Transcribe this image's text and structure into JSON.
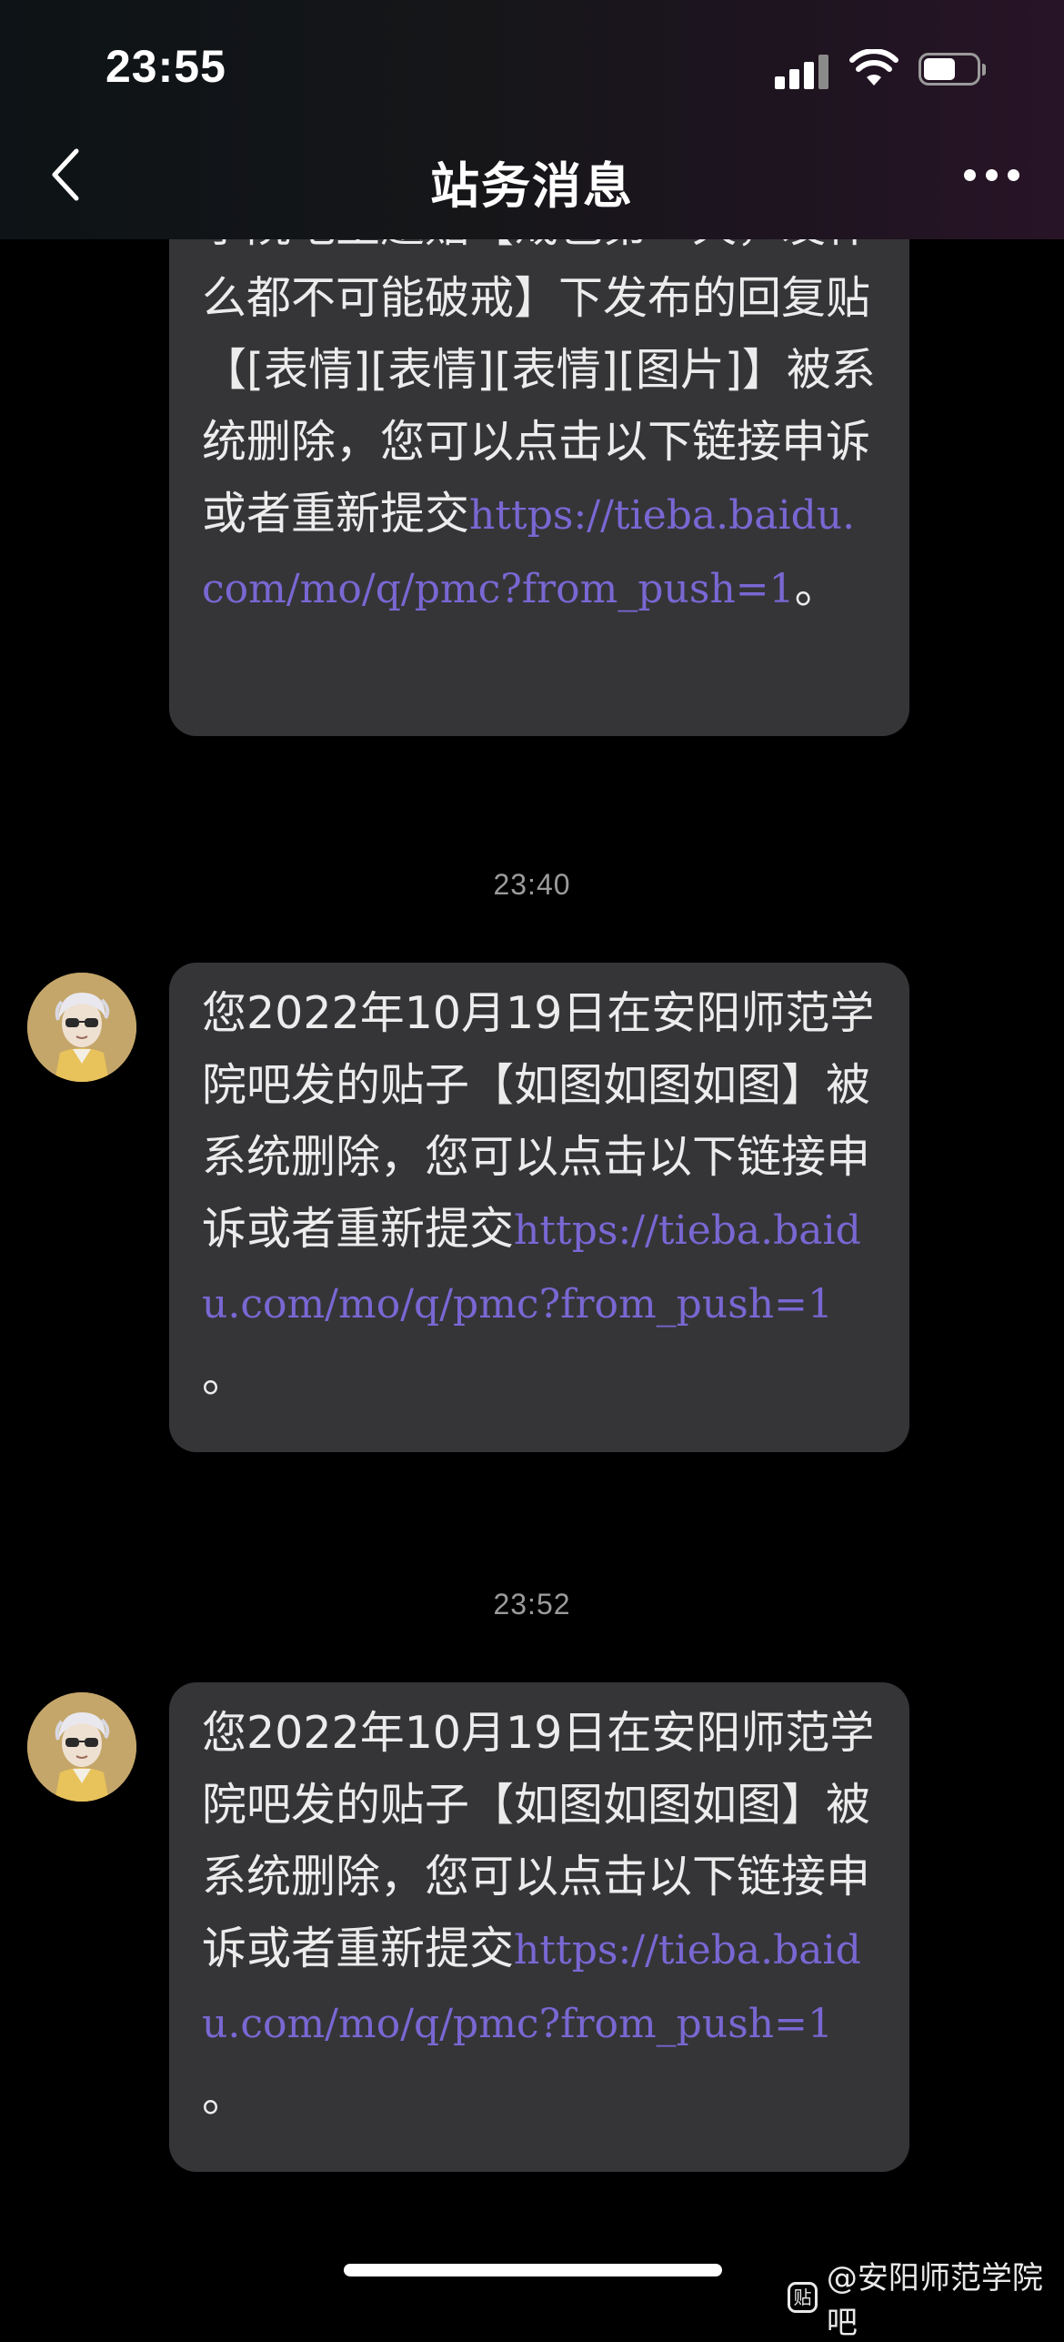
{
  "status_bar": {
    "time": "23:55",
    "battery_level": 0.6
  },
  "nav": {
    "title": "站务消息",
    "back_icon": "chevron-left-icon",
    "more_icon": "more-dots-icon"
  },
  "messages": [
    {
      "text": "学院吧主题贴【戒色第一天，发什么都不可能破戒】下发布的回复贴【[表情][表情][表情][图片]】被系统删除，您可以点击以下链接申诉或者重新提交",
      "link": "https://tieba.baidu.com/mo/q/pmc?from_push=1",
      "end": "。"
    },
    {
      "time": "23:40",
      "text": "您2022年10月19日在安阳师范学院吧发的贴子【如图如图如图】被系统删除，您可以点击以下链接申诉或者重新提交",
      "link": "https://tieba.baidu.com/mo/q/pmc?from_push=1",
      "end": "。"
    },
    {
      "time": "23:52",
      "text": "您2022年10月19日在安阳师范学院吧发的贴子【如图如图如图】被系统删除，您可以点击以下链接申诉或者重新提交",
      "link": "https://tieba.baidu.com/mo/q/pmc?from_push=1",
      "end": "。"
    }
  ],
  "watermark": {
    "logo": "贴",
    "text": "@安阳师范学院吧"
  },
  "colors": {
    "bubble": "#353538",
    "link": "#7a67d3",
    "background": "#000000"
  }
}
